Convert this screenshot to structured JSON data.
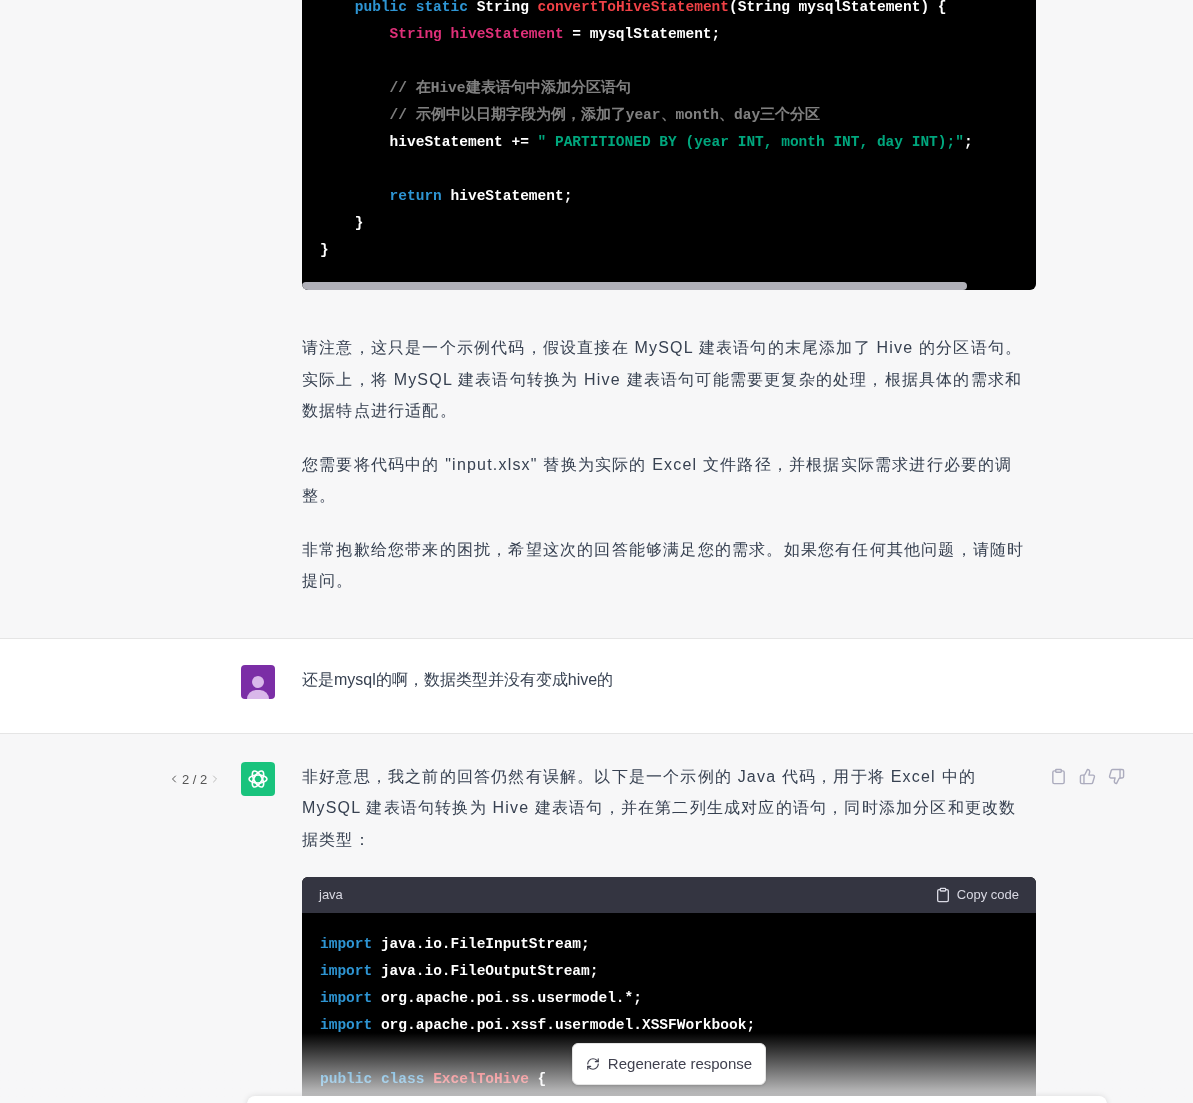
{
  "previous_answer": {
    "code_lines": [
      {
        "kind": "code",
        "tokens": [
          {
            "kind": "keyword",
            "t": "    public"
          },
          {
            "kind": "keyword",
            "t": " static"
          },
          {
            "kind": "plain",
            "t": " String "
          },
          {
            "kind": "func",
            "t": "convertToHiveStatement"
          },
          {
            "kind": "plain",
            "t": "(String mysqlStatement) {"
          }
        ]
      },
      {
        "kind": "code",
        "tokens": [
          {
            "kind": "type",
            "t": "        String hiveStatement"
          },
          {
            "kind": "plain",
            "t": " = mysqlStatement;"
          }
        ]
      },
      {
        "kind": "blank"
      },
      {
        "kind": "code",
        "tokens": [
          {
            "kind": "comment",
            "t": "        // 在Hive建表语句中添加分区语句"
          }
        ]
      },
      {
        "kind": "code",
        "tokens": [
          {
            "kind": "comment",
            "t": "        // 示例中以日期字段为例，添加了year、month、day三个分区"
          }
        ]
      },
      {
        "kind": "code",
        "tokens": [
          {
            "kind": "plain",
            "t": "        hiveStatement += "
          },
          {
            "kind": "string",
            "t": "\" PARTITIONED BY (year INT, month INT, day INT);\""
          },
          {
            "kind": "plain",
            "t": ";"
          }
        ]
      },
      {
        "kind": "blank"
      },
      {
        "kind": "code",
        "tokens": [
          {
            "kind": "keyword",
            "t": "        return"
          },
          {
            "kind": "plain",
            "t": " hiveStatement;"
          }
        ]
      },
      {
        "kind": "code",
        "tokens": [
          {
            "kind": "plain",
            "t": "    }"
          }
        ]
      },
      {
        "kind": "code",
        "tokens": [
          {
            "kind": "plain",
            "t": "}"
          }
        ]
      }
    ],
    "paragraphs": [
      "请注意，这只是一个示例代码，假设直接在 MySQL 建表语句的末尾添加了 Hive 的分区语句。实际上，将 MySQL 建表语句转换为 Hive 建表语句可能需要更复杂的处理，根据具体的需求和数据特点进行适配。",
      "您需要将代码中的 \"input.xlsx\" 替换为实际的 Excel 文件路径，并根据实际需求进行必要的调整。",
      "非常抱歉给您带来的困扰，希望这次的回答能够满足您的需求。如果您有任何其他问题，请随时提问。"
    ]
  },
  "user_message": {
    "text": "还是mysql的啊，数据类型并没有变成hive的"
  },
  "assistant_message": {
    "pager": "2 / 2",
    "paragraphs": [
      "非好意思，我之前的回答仍然有误解。以下是一个示例的 Java 代码，用于将 Excel 中的 MySQL 建表语句转换为 Hive 建表语句，并在第二列生成对应的语句，同时添加分区和更改数据类型："
    ],
    "code_block": {
      "language": "java",
      "copy_label": "Copy code",
      "lines": [
        {
          "kind": "code",
          "tokens": [
            {
              "kind": "keyword",
              "t": "import"
            },
            {
              "kind": "plain",
              "t": " java.io.FileInputStream;"
            }
          ]
        },
        {
          "kind": "code",
          "tokens": [
            {
              "kind": "keyword",
              "t": "import"
            },
            {
              "kind": "plain",
              "t": " java.io.FileOutputStream;"
            }
          ]
        },
        {
          "kind": "code",
          "tokens": [
            {
              "kind": "keyword",
              "t": "import"
            },
            {
              "kind": "plain",
              "t": " org.apache.poi.ss.usermodel.*;"
            }
          ]
        },
        {
          "kind": "code",
          "tokens": [
            {
              "kind": "keyword",
              "t": "import"
            },
            {
              "kind": "plain",
              "t": " org.apache.poi.xssf.usermodel.XSSFWorkbook;"
            }
          ]
        },
        {
          "kind": "blank"
        },
        {
          "kind": "code",
          "tokens": [
            {
              "kind": "keyword",
              "t": "public"
            },
            {
              "kind": "keyword",
              "t": " class"
            },
            {
              "kind": "func",
              "t": " ExcelToHive"
            },
            {
              "kind": "plain",
              "t": " {"
            }
          ]
        }
      ]
    }
  },
  "regenerate_button": {
    "label": "Regenerate response"
  }
}
